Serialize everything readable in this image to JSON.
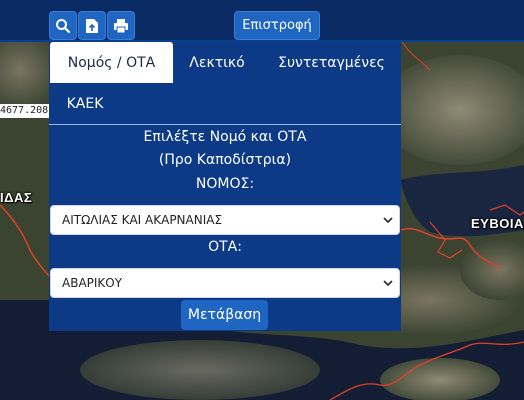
{
  "toolbar": {
    "search_icon": "search-icon",
    "upload_icon": "file-upload-icon",
    "print_icon": "printer-icon",
    "back_label": "Επιστροφή"
  },
  "map": {
    "coordinate_readout": "4677.208",
    "labels": [
      "ΙΔΑΣ",
      "ΕΥΒΟΙΑ"
    ]
  },
  "panel": {
    "tabs": [
      {
        "label": "Νομός / ΟΤΑ",
        "active": true
      },
      {
        "label": "Λεκτικό",
        "active": false
      },
      {
        "label": "Συντεταγμένες",
        "active": false
      },
      {
        "label": "ΚΑΕΚ",
        "active": false
      }
    ],
    "instruction_line1": "Επιλέξτε Νομό και ΟΤΑ",
    "instruction_line2": "(Προ Καποδίστρια)",
    "nomos_label": "ΝΟΜΟΣ:",
    "nomos_value": "ΑΙΤΩΛΙΑΣ ΚΑΙ ΑΚΑΡΝΑΝΙΑΣ",
    "ota_label": "ΟΤΑ:",
    "ota_value": "ΑΒΑΡΙΚΟΥ",
    "go_label": "Μετάβαση"
  },
  "colors": {
    "topbar": "#0a2a63",
    "panel": "#0c3a86",
    "button": "#1f66c3",
    "boundary": "#e0402a"
  }
}
